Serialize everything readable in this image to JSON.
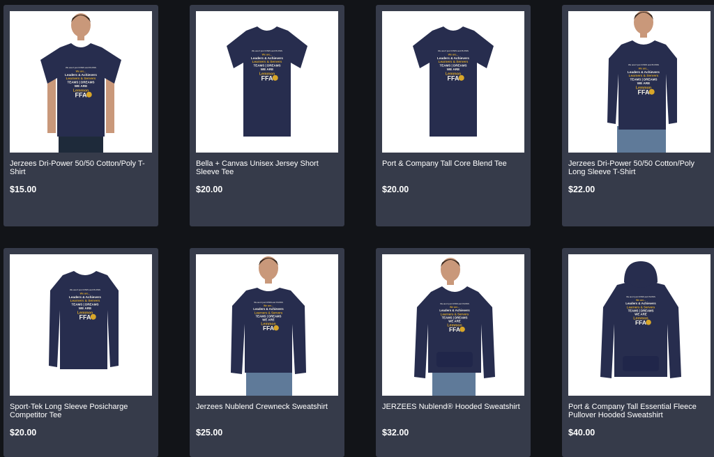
{
  "products": [
    {
      "name": "Jerzees Dri-Power 50/50 Cotton/Poly T-Shirt",
      "price": "$15.00",
      "garment": "tshirt-model",
      "image_icon": "tshirt-model-icon"
    },
    {
      "name": "Bella + Canvas Unisex Jersey Short Sleeve Tee",
      "price": "$20.00",
      "garment": "tshirt",
      "image_icon": "tshirt-icon"
    },
    {
      "name": "Port & Company Tall Core Blend Tee",
      "price": "$20.00",
      "garment": "tshirt",
      "image_icon": "tshirt-icon"
    },
    {
      "name": "Jerzees Dri-Power 50/50 Cotton/Poly Long Sleeve T-Shirt",
      "price": "$22.00",
      "garment": "longsleeve-model",
      "image_icon": "longsleeve-model-icon"
    },
    {
      "name": "Sport-Tek Long Sleeve Posicharge Competitor Tee",
      "price": "$20.00",
      "garment": "longsleeve",
      "image_icon": "longsleeve-icon"
    },
    {
      "name": "Jerzees Nublend Crewneck Sweatshirt",
      "price": "$25.00",
      "garment": "sweatshirt-model",
      "image_icon": "sweatshirt-model-icon"
    },
    {
      "name": "JERZEES Nublend® Hooded Sweatshirt",
      "price": "$32.00",
      "garment": "hoodie-model",
      "image_icon": "hoodie-model-icon"
    },
    {
      "name": "Port & Company Tall Essential Fleece Pullover Hooded Sweatshirt",
      "price": "$40.00",
      "garment": "hoodie",
      "image_icon": "hoodie-icon"
    }
  ],
  "print": {
    "line1": "We aren't just COWS and PLOWS",
    "line2": "We are...",
    "line3": "Leaders & Achievers",
    "line4": "Learners & Servers",
    "line5": "TEAMS | DREAMS",
    "line6": "WE ARE",
    "line7": "Lemmon",
    "line8": "FFA"
  },
  "colors": {
    "background": "#121418",
    "card": "#363b4a",
    "garment": "#272d4e",
    "skin": "#c9987a",
    "jeans": "#5f7a99",
    "print_gold": "#d8a629",
    "print_white": "#f4f1e6"
  }
}
